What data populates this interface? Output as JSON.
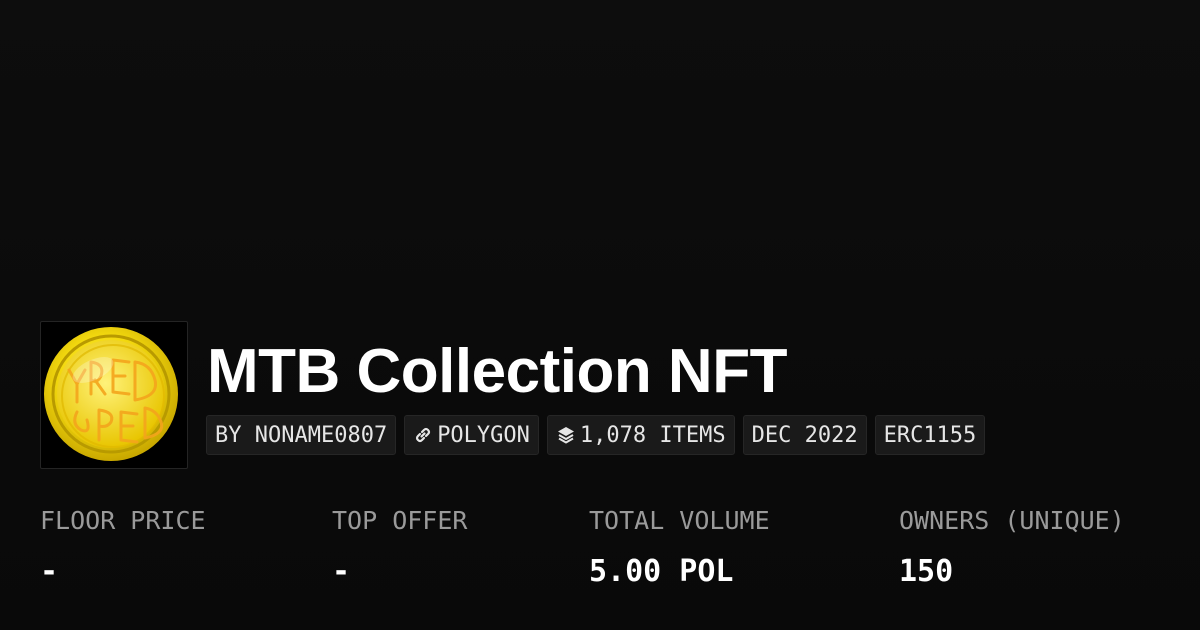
{
  "collection": {
    "title": "MTB Collection NFT",
    "avatar_icon": "gold-coin-logo-icon",
    "avatar_logo_text": "YRED"
  },
  "tags": {
    "creator": "BY NONAME0807",
    "chain": "POLYGON",
    "chain_icon": "link-icon",
    "items": "1,078 ITEMS",
    "items_icon": "layers-icon",
    "date": "DEC 2022",
    "standard": "ERC1155"
  },
  "stats": {
    "floor_price": {
      "label": "FLOOR PRICE",
      "value": "-"
    },
    "top_offer": {
      "label": "TOP OFFER",
      "value": "-"
    },
    "total_volume": {
      "label": "TOTAL VOLUME",
      "value": "5.00 POL"
    },
    "owners": {
      "label": "OWNERS (UNIQUE)",
      "value": "150"
    }
  },
  "colors": {
    "background": "#0b0b0b",
    "tag_background": "#1a1a1a",
    "label_gray": "#9a9a9a",
    "coin_gold": "#f2d40e"
  }
}
